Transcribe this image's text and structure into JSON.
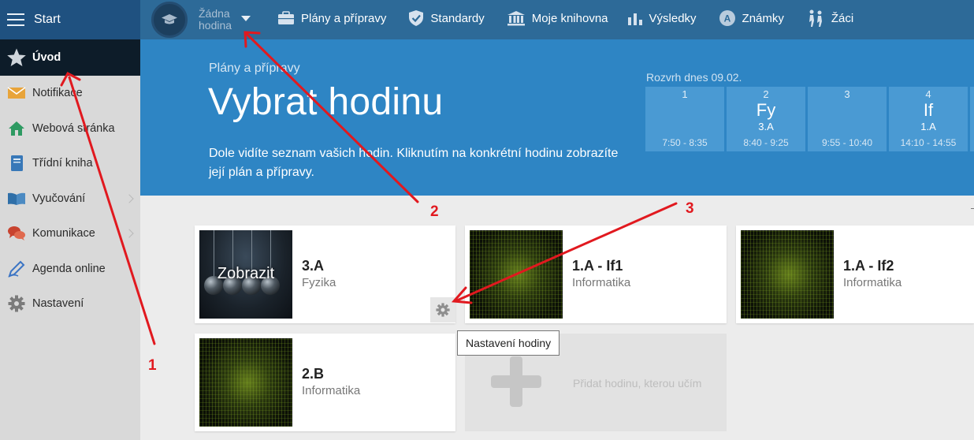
{
  "topbar": {
    "start_label": "Start",
    "lesson_selector": {
      "line1": "Žádna",
      "line2": "hodina"
    },
    "nav": [
      {
        "label": "Plány a přípravy",
        "icon": "briefcase-icon"
      },
      {
        "label": "Standardy",
        "icon": "shield-check-icon"
      },
      {
        "label": "Moje knihovna",
        "icon": "library-icon"
      },
      {
        "label": "Výsledky",
        "icon": "bar-chart-icon"
      },
      {
        "label": "Známky",
        "icon": "grade-badge-icon"
      },
      {
        "label": "Žáci",
        "icon": "students-icon"
      }
    ]
  },
  "sidebar": {
    "items": [
      {
        "label": "Úvod",
        "icon": "star-icon",
        "active": true
      },
      {
        "label": "Notifikace",
        "icon": "envelope-icon"
      },
      {
        "label": "Webová stránka",
        "icon": "home-icon"
      },
      {
        "label": "Třídní kniha",
        "icon": "book-icon"
      },
      {
        "label": "Vyučování",
        "icon": "open-book-icon",
        "has_submenu": true
      },
      {
        "label": "Komunikace",
        "icon": "chat-bubbles-icon",
        "has_submenu": true
      },
      {
        "label": "Agenda online",
        "icon": "pen-icon"
      },
      {
        "label": "Nastavení",
        "icon": "gear-icon"
      }
    ]
  },
  "hero": {
    "breadcrumb": "Plány a přípravy",
    "title": "Vybrat hodinu",
    "description": "Dole vidíte seznam vašich hodin. Kliknutím na konkrétní hodinu zobrazíte její plán a přípravy."
  },
  "schedule": {
    "label": "Rozvrh dnes 09.02.",
    "slots": [
      {
        "num": "1",
        "subject": "",
        "class": "",
        "time": "7:50 - 8:35"
      },
      {
        "num": "2",
        "subject": "Fy",
        "class": "3.A",
        "time": "8:40 - 9:25"
      },
      {
        "num": "3",
        "subject": "",
        "class": "",
        "time": "9:55 - 10:40"
      },
      {
        "num": "4",
        "subject": "If",
        "class": "1.A",
        "time": "14:10 - 14:55"
      }
    ]
  },
  "lessons": [
    {
      "class": "3.A",
      "subject": "Fyzika",
      "thumb_label": "Zobrazit",
      "thumb": "physics"
    },
    {
      "class": "1.A - If1",
      "subject": "Informatika",
      "thumb": "matrix"
    },
    {
      "class": "1.A - If2",
      "subject": "Informatika",
      "thumb": "matrix"
    },
    {
      "class": "2.B",
      "subject": "Informatika",
      "thumb": "matrix"
    }
  ],
  "tooltip": "Nastavení hodiny",
  "add_lesson": {
    "label": "Přidat hodinu, kterou učím"
  },
  "annotations": {
    "color": "#e1191f",
    "labels": [
      "1",
      "2",
      "3"
    ]
  }
}
